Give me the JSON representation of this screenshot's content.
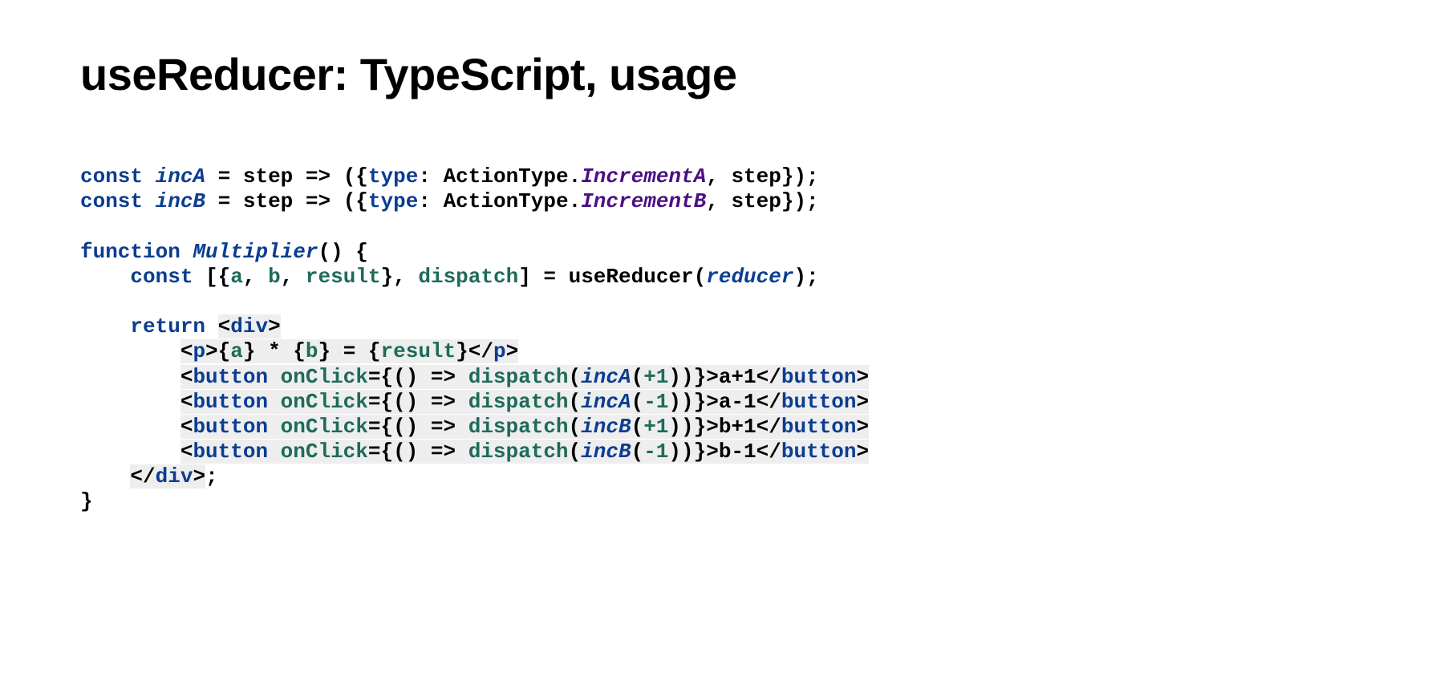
{
  "title": "useReducer: TypeScript, usage",
  "code": {
    "l1": {
      "const": "const",
      "name": "incA",
      "eq": " = ",
      "step": "step",
      "arrow": " => ",
      "op": "({",
      "type": "type",
      "colon": ": ",
      "enum": "ActionType.",
      "member": "IncrementA",
      "rest": ", step});"
    },
    "l2": {
      "const": "const",
      "name": "incB",
      "eq": " = ",
      "step": "step",
      "arrow": " => ",
      "op": "({",
      "type": "type",
      "colon": ": ",
      "enum": "ActionType.",
      "member": "IncrementB",
      "rest": ", step});"
    },
    "l3": {
      "fn": "function",
      "sp": " ",
      "name": "Multiplier",
      "rest": "() {"
    },
    "l4": {
      "indent": "    ",
      "const": "const",
      "sp": " ",
      "op": "[{",
      "a": "a",
      "c1": ", ",
      "b": "b",
      "c2": ", ",
      "r": "result",
      "cl": "}, ",
      "disp": "dispatch",
      "rest": "] = useReducer(",
      "reducer": "reducer",
      "rest2": ");"
    },
    "l5": {
      "indent": "    ",
      "ret": "return",
      "sp": " ",
      "lt": "<",
      "tag": "div",
      "gt": ">"
    },
    "l6": {
      "indent": "        ",
      "lt": "<",
      "tag": "p",
      "gt": ">",
      "t1": "{",
      "a": "a",
      "t2": "} * {",
      "b": "b",
      "t3": "} = {",
      "r": "result",
      "t4": "}",
      "lt2": "</",
      "tag2": "p",
      "gt2": ">"
    },
    "btn1": {
      "indent": "        ",
      "open": "<",
      "tag": "button",
      "sp": " ",
      "attr": "onClick",
      "eq": "=",
      "arg": "{() => ",
      "disp": "dispatch",
      "op": "(",
      "fn": "incA",
      "op2": "(",
      "num": "+1",
      "op3": "))}",
      "gt": ">",
      "text": "a+1",
      "close": "</",
      "ctag": "button",
      "cgt": ">"
    },
    "btn2": {
      "indent": "        ",
      "open": "<",
      "tag": "button",
      "sp": " ",
      "attr": "onClick",
      "eq": "=",
      "arg": "{() => ",
      "disp": "dispatch",
      "op": "(",
      "fn": "incA",
      "op2": "(",
      "num": "-1",
      "op3": "))}",
      "gt": ">",
      "text": "a-1",
      "close": "</",
      "ctag": "button",
      "cgt": ">"
    },
    "btn3": {
      "indent": "        ",
      "open": "<",
      "tag": "button",
      "sp": " ",
      "attr": "onClick",
      "eq": "=",
      "arg": "{() => ",
      "disp": "dispatch",
      "op": "(",
      "fn": "incB",
      "op2": "(",
      "num": "+1",
      "op3": "))}",
      "gt": ">",
      "text": "b+1",
      "close": "</",
      "ctag": "button",
      "cgt": ">"
    },
    "btn4": {
      "indent": "        ",
      "open": "<",
      "tag": "button",
      "sp": " ",
      "attr": "onClick",
      "eq": "=",
      "arg": "{() => ",
      "disp": "dispatch",
      "op": "(",
      "fn": "incB",
      "op2": "(",
      "num": "-1",
      "op3": "))}",
      "gt": ">",
      "text": "b-1",
      "close": "</",
      "ctag": "button",
      "cgt": ">"
    },
    "l11": {
      "indent": "    ",
      "lt": "</",
      "tag": "div",
      "gt": ">",
      "semi": ";"
    },
    "l12": "}"
  }
}
